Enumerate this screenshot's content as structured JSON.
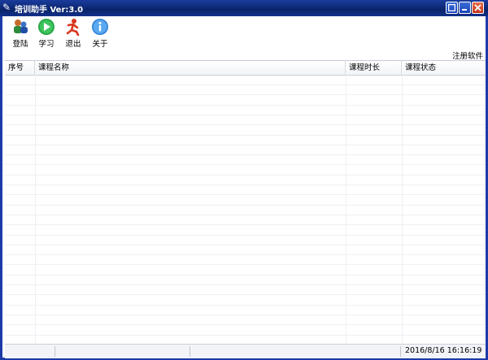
{
  "window": {
    "title": "培训助手 Ver:3.0"
  },
  "toolbar": {
    "login_label": "登陆",
    "study_label": "学习",
    "exit_label": "退出",
    "about_label": "关于",
    "register_label": "注册软件"
  },
  "table": {
    "columns": [
      "序号",
      "课程名称",
      "课程时长",
      "课程状态"
    ],
    "rows": []
  },
  "status": {
    "datetime": "2016/8/16 16:16:19"
  },
  "colors": {
    "titlebar": "#0a246a",
    "close": "#c23519"
  }
}
